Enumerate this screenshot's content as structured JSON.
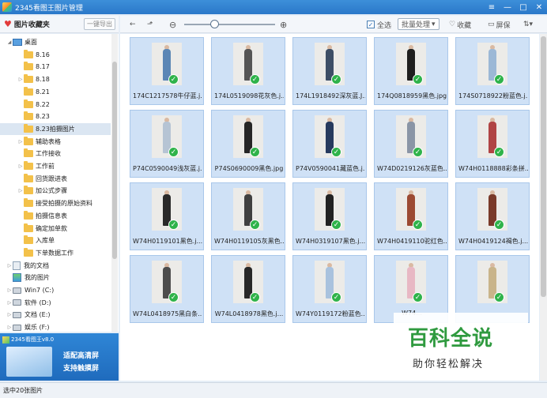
{
  "app": {
    "title": "2345看图王图片管理",
    "controls": {
      "menu": "≡",
      "minimize": "—",
      "maximize": "□",
      "close": "✕"
    }
  },
  "left_panel": {
    "header": "图片收藏夹",
    "export_button": "一键导出",
    "tree": [
      {
        "label": "桌面",
        "type": "desktop",
        "arrow": "◢",
        "indent": 0,
        "selected": false
      },
      {
        "label": "8.16",
        "type": "folder",
        "arrow": "",
        "indent": 1,
        "selected": false
      },
      {
        "label": "8.17",
        "type": "folder",
        "arrow": "",
        "indent": 1,
        "selected": false
      },
      {
        "label": "8.18",
        "type": "folder",
        "arrow": "▷",
        "indent": 1,
        "selected": false
      },
      {
        "label": "8.21",
        "type": "folder",
        "arrow": "",
        "indent": 1,
        "selected": false
      },
      {
        "label": "8.22",
        "type": "folder",
        "arrow": "",
        "indent": 1,
        "selected": false
      },
      {
        "label": "8.23",
        "type": "folder",
        "arrow": "",
        "indent": 1,
        "selected": false
      },
      {
        "label": "8.23拍摄图片",
        "type": "folder",
        "arrow": "",
        "indent": 1,
        "selected": true
      },
      {
        "label": "辅助表格",
        "type": "folder",
        "arrow": "▷",
        "indent": 1,
        "selected": false
      },
      {
        "label": "工作接收",
        "type": "folder",
        "arrow": "",
        "indent": 1,
        "selected": false
      },
      {
        "label": "工作前",
        "type": "folder",
        "arrow": "▷",
        "indent": 1,
        "selected": false
      },
      {
        "label": "回货跟进表",
        "type": "folder",
        "arrow": "",
        "indent": 1,
        "selected": false
      },
      {
        "label": "加公式步骤",
        "type": "folder",
        "arrow": "▷",
        "indent": 1,
        "selected": false
      },
      {
        "label": "接受拍摄的原始资料",
        "type": "folder",
        "arrow": "",
        "indent": 1,
        "selected": false
      },
      {
        "label": "拍摄信息表",
        "type": "folder",
        "arrow": "",
        "indent": 1,
        "selected": false
      },
      {
        "label": "确定加单款",
        "type": "folder",
        "arrow": "",
        "indent": 1,
        "selected": false
      },
      {
        "label": "入库单",
        "type": "folder",
        "arrow": "",
        "indent": 1,
        "selected": false
      },
      {
        "label": "下单数据工作",
        "type": "folder",
        "arrow": "",
        "indent": 1,
        "selected": false
      },
      {
        "label": "我的文档",
        "type": "documents",
        "arrow": "▷",
        "indent": 0,
        "selected": false
      },
      {
        "label": "我的图片",
        "type": "pictures",
        "arrow": "",
        "indent": 0,
        "selected": false
      },
      {
        "label": "Win7 (C:)",
        "type": "drive",
        "arrow": "▷",
        "indent": 0,
        "selected": false
      },
      {
        "label": "软件 (D:)",
        "type": "drive",
        "arrow": "▷",
        "indent": 0,
        "selected": false
      },
      {
        "label": "文档 (E:)",
        "type": "drive",
        "arrow": "▷",
        "indent": 0,
        "selected": false
      },
      {
        "label": "娱乐 (F:)",
        "type": "drive",
        "arrow": "▷",
        "indent": 0,
        "selected": false
      }
    ]
  },
  "ad": {
    "brand": "2345看图王v8.0",
    "line1": "适配高清屏",
    "line2": "支持触摸屏"
  },
  "toolbar": {
    "back_icon": "←",
    "up_icon": "⬏",
    "zoom_out_icon": "⊖",
    "zoom_in_icon": "⊕",
    "select_all_label": "全选",
    "select_all_checked": "✓",
    "batch_label": "批量处理",
    "batch_arrow": "▾",
    "favorite_icon": "♡",
    "favorite_label": "收藏",
    "screensaver_icon": "▭",
    "screensaver_label": "屏保",
    "sort_icon": "⇅",
    "sort_arrow": "▾"
  },
  "images": [
    {
      "name": "174C1217578牛仔蓝.j...",
      "outfit": "#5b86b5"
    },
    {
      "name": "174L0519098花灰色.j...",
      "outfit": "#555555"
    },
    {
      "name": "174L1918492深灰蓝.J...",
      "outfit": "#3d4e66"
    },
    {
      "name": "174Q0818959黑色.jpg",
      "outfit": "#1f1f1f"
    },
    {
      "name": "174S0718922粉蓝色.j...",
      "outfit": "#9cb8d6"
    },
    {
      "name": "P74C0590049浅灰蓝.j...",
      "outfit": "#b6c4d4"
    },
    {
      "name": "P74S0690009黑色.jpg",
      "outfit": "#262626"
    },
    {
      "name": "P74V0590041藏蓝色.j...",
      "outfit": "#263a5e"
    },
    {
      "name": "W74D0219126灰蓝色...",
      "outfit": "#8a95a6"
    },
    {
      "name": "W74H0118888彩条拼...",
      "outfit": "#b04444"
    },
    {
      "name": "W74H0119101黑色.j...",
      "outfit": "#2a2a2a"
    },
    {
      "name": "W74H0119105灰黑色...",
      "outfit": "#404040"
    },
    {
      "name": "W74H0319107黑色.j...",
      "outfit": "#222222"
    },
    {
      "name": "W74H0419110驼红色...",
      "outfit": "#9c4a33"
    },
    {
      "name": "W74H0419124褐色.j...",
      "outfit": "#7a3a2a"
    },
    {
      "name": "W74L0418975黑白条...",
      "outfit": "#4d4d4d"
    },
    {
      "name": "W74L0418978黑色.j...",
      "outfit": "#282828"
    },
    {
      "name": "W74Y0119172粉蓝色...",
      "outfit": "#a9c2de"
    },
    {
      "name": "W74...",
      "outfit": "#e8b8c4"
    },
    {
      "name": "",
      "outfit": "#c9b48a"
    }
  ],
  "check_mark": "✓",
  "watermark": {
    "main": "百科全说",
    "sub": "助你轻松解决"
  },
  "status": {
    "text": "选中20张图片"
  }
}
